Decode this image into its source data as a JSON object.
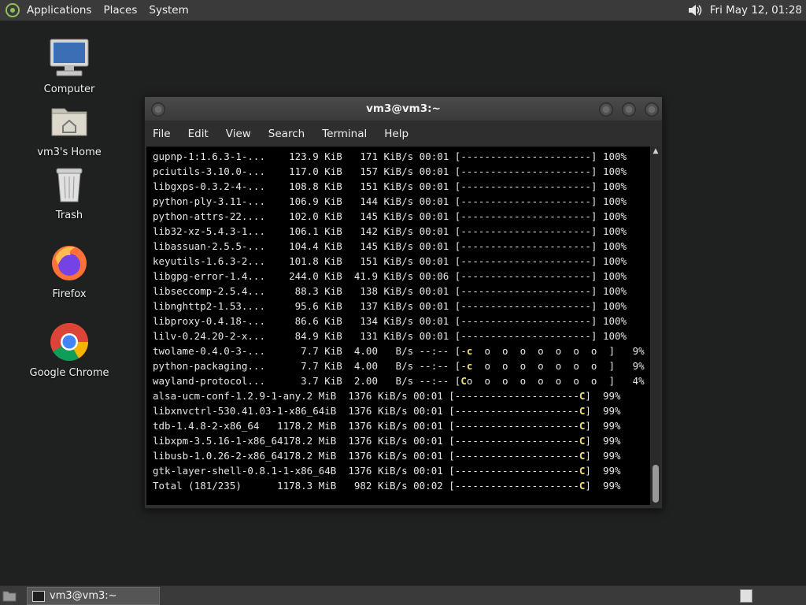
{
  "top_panel": {
    "menus": [
      "Applications",
      "Places",
      "System"
    ],
    "clock": "Fri May 12, 01:28"
  },
  "desktop": {
    "icons": [
      {
        "label": "Computer"
      },
      {
        "label": "vm3's Home"
      },
      {
        "label": "Trash"
      },
      {
        "label": "Firefox"
      },
      {
        "label": "Google Chrome"
      }
    ]
  },
  "window": {
    "title": "vm3@vm3:~",
    "menu": [
      "File",
      "Edit",
      "View",
      "Search",
      "Terminal",
      "Help"
    ],
    "terminal_lines": [
      {
        "text": "gupnp-1:1.6.3-1-...    123.9 KiB   171 KiB/s 00:01 [----------------------] 100%"
      },
      {
        "text": "pciutils-3.10.0-...    117.0 KiB   157 KiB/s 00:01 [----------------------] 100%"
      },
      {
        "text": "libgxps-0.3.2-4-...    108.8 KiB   151 KiB/s 00:01 [----------------------] 100%"
      },
      {
        "text": "python-ply-3.11-...    106.9 KiB   144 KiB/s 00:01 [----------------------] 100%"
      },
      {
        "text": "python-attrs-22....    102.0 KiB   145 KiB/s 00:01 [----------------------] 100%"
      },
      {
        "text": "lib32-xz-5.4.3-1...    106.1 KiB   142 KiB/s 00:01 [----------------------] 100%"
      },
      {
        "text": "libassuan-2.5.5-...    104.4 KiB   145 KiB/s 00:01 [----------------------] 100%"
      },
      {
        "text": "keyutils-1.6.3-2...    101.8 KiB   151 KiB/s 00:01 [----------------------] 100%"
      },
      {
        "text": "libgpg-error-1.4...    244.0 KiB  41.9 KiB/s 00:06 [----------------------] 100%"
      },
      {
        "text": "libseccomp-2.5.4...     88.3 KiB   138 KiB/s 00:01 [----------------------] 100%"
      },
      {
        "text": "libnghttp2-1.53....     95.6 KiB   137 KiB/s 00:01 [----------------------] 100%"
      },
      {
        "text": "libproxy-0.4.18-...     86.6 KiB   134 KiB/s 00:01 [----------------------] 100%"
      },
      {
        "text": "lilv-0.24.20-2-x...     84.9 KiB   131 KiB/s 00:01 [----------------------] 100%"
      },
      {
        "pre": "twolame-0.4.0-3-...      7.7 KiB  4.00   B/s --:-- [-",
        "hl": "c",
        "post": "  o  o  o  o  o  o  o  ]   9%"
      },
      {
        "pre": "python-packaging...      7.7 KiB  4.00   B/s --:-- [-",
        "hl": "c",
        "post": "  o  o  o  o  o  o  o  ]   9%"
      },
      {
        "pre": "wayland-protocol...      3.7 KiB  2.00   B/s --:-- [",
        "hl": "C",
        "post": "o  o  o  o  o  o  o  o  ]   4%"
      },
      {
        "pre": "alsa-ucm-conf-1.2.9-1-any.2 MiB  1376 KiB/s 00:01 [---------------------",
        "hl": "C",
        "post": "]  99%"
      },
      {
        "pre": "libxnvctrl-530.41.03-1-x86_64iB  1376 KiB/s 00:01 [---------------------",
        "hl": "C",
        "post": "]  99%"
      },
      {
        "pre": "tdb-1.4.8-2-x86_64   1178.2 MiB  1376 KiB/s 00:01 [---------------------",
        "hl": "C",
        "post": "]  99%"
      },
      {
        "pre": "libxpm-3.5.16-1-x86_64178.2 MiB  1376 KiB/s 00:01 [---------------------",
        "hl": "C",
        "post": "]  99%"
      },
      {
        "pre": "libusb-1.0.26-2-x86_64178.2 MiB  1376 KiB/s 00:01 [---------------------",
        "hl": "C",
        "post": "]  99%"
      },
      {
        "pre": "gtk-layer-shell-0.8.1-1-x86_64B  1376 KiB/s 00:01 [---------------------",
        "hl": "C",
        "post": "]  99%"
      },
      {
        "pre": "Total (181/235)      1178.3 MiB   982 KiB/s 00:02 [---------------------",
        "hl": "C",
        "post": "]  99%"
      }
    ]
  },
  "taskbar": {
    "task_label": "vm3@vm3:~"
  },
  "colors": {
    "panel": "#3a3a3a",
    "desktop": "#1f2120",
    "terminal_bg": "#000000",
    "terminal_fg": "#e6e6e6",
    "pacman_highlight": "#f3e36c"
  }
}
